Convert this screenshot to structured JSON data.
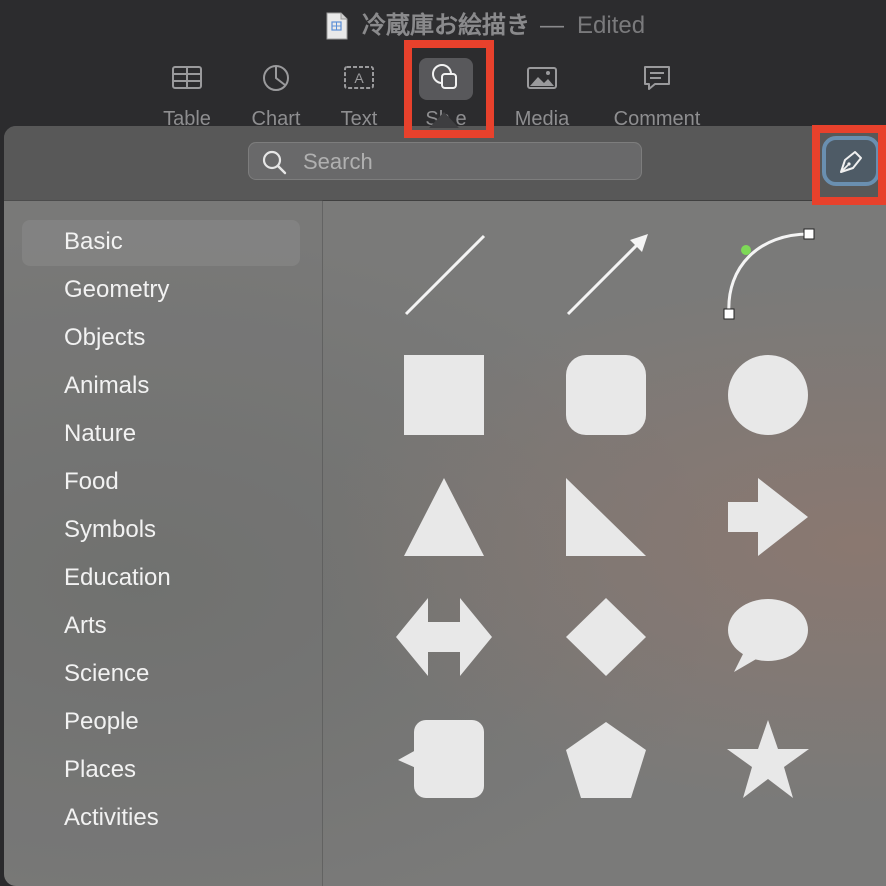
{
  "window": {
    "title": "冷蔵庫お絵描き",
    "separator": "—",
    "status": "Edited"
  },
  "toolbar": {
    "items": [
      {
        "label": "Table",
        "icon": "table-icon"
      },
      {
        "label": "Chart",
        "icon": "chart-icon"
      },
      {
        "label": "Text",
        "icon": "text-box-icon"
      },
      {
        "label": "Shape",
        "icon": "shape-icon",
        "active": true,
        "visible_label": "Sh  e"
      },
      {
        "label": "Media",
        "icon": "media-icon"
      },
      {
        "label": "Comment",
        "icon": "comment-icon"
      }
    ]
  },
  "shape_library": {
    "search": {
      "placeholder": "Search",
      "value": ""
    },
    "pen_tool_icon": "pen-icon",
    "categories": [
      {
        "label": "Basic",
        "selected": true
      },
      {
        "label": "Geometry"
      },
      {
        "label": "Objects"
      },
      {
        "label": "Animals"
      },
      {
        "label": "Nature"
      },
      {
        "label": "Food"
      },
      {
        "label": "Symbols"
      },
      {
        "label": "Education"
      },
      {
        "label": "Arts"
      },
      {
        "label": "Science"
      },
      {
        "label": "People"
      },
      {
        "label": "Places"
      },
      {
        "label": "Activities"
      }
    ],
    "shapes": [
      "line",
      "arrow-line",
      "curve",
      "square",
      "rounded-square",
      "circle",
      "triangle",
      "right-triangle",
      "arrow-right",
      "double-arrow",
      "diamond",
      "speech-bubble",
      "callout-square",
      "pentagon",
      "star"
    ]
  },
  "colors": {
    "accent_highlight": "#e8412c",
    "shape_fill": "#e8e8e8",
    "curve_control_point": "#7ed957"
  }
}
